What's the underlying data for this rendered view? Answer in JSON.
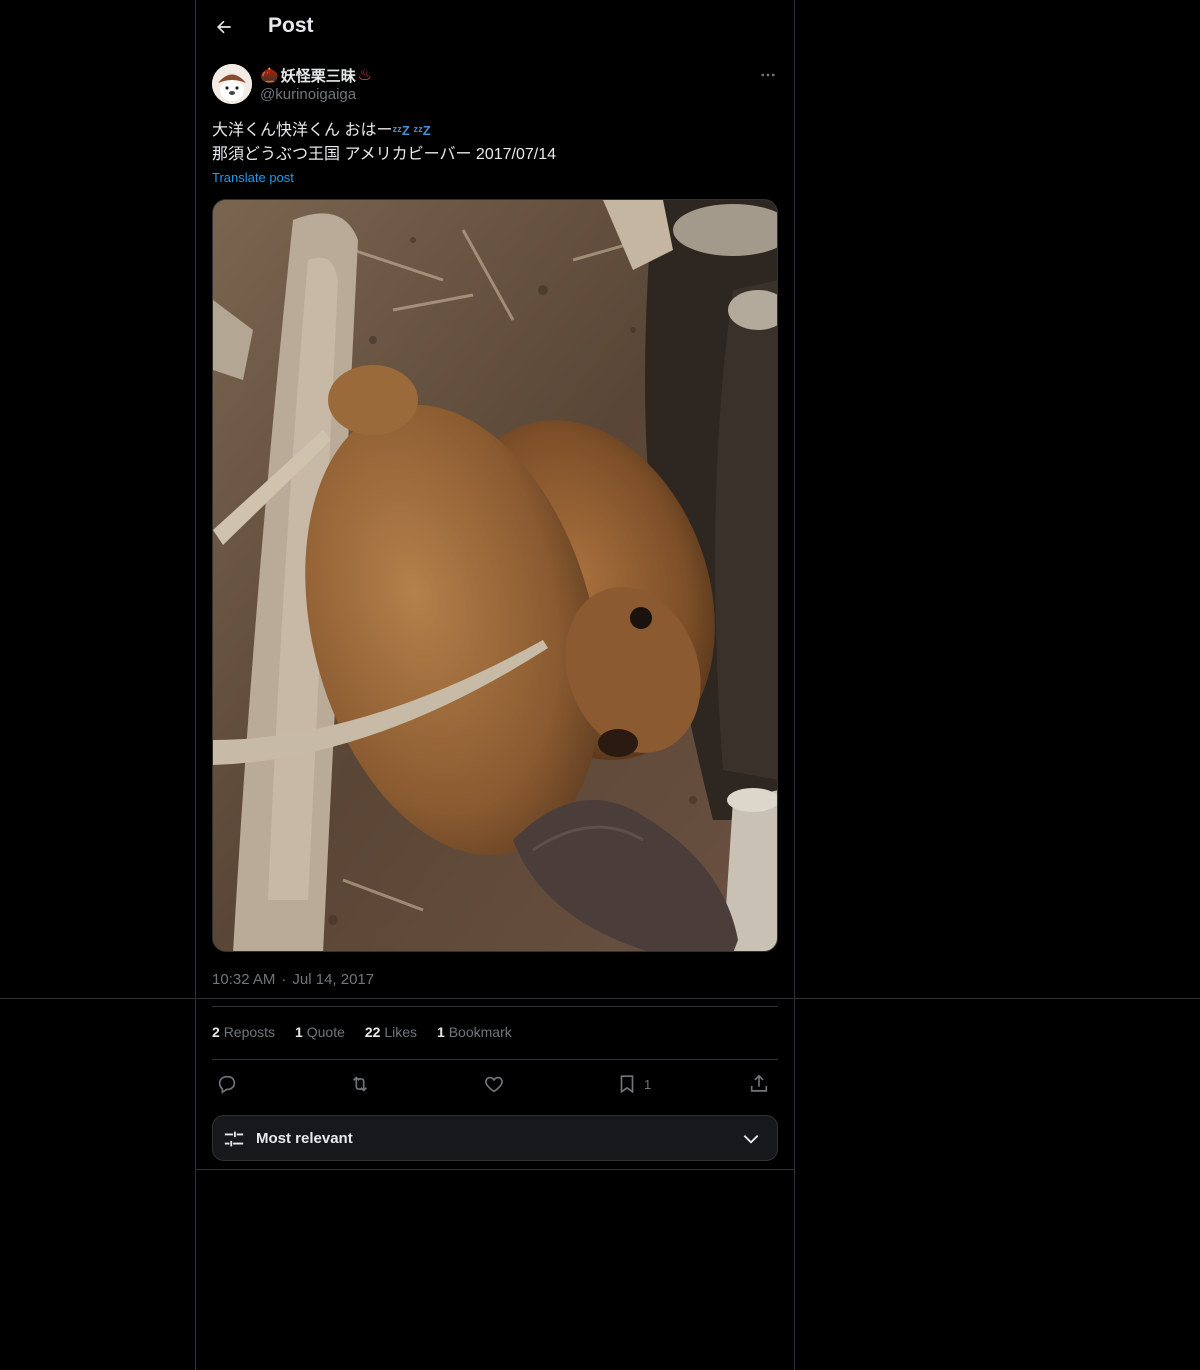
{
  "header": {
    "title": "Post"
  },
  "author": {
    "display_name": "妖怪栗三昧",
    "emoji_prefix": "🌰",
    "emoji_suffix": "♨",
    "handle": "@kurinoigaiga"
  },
  "post": {
    "line1": "大洋くん快洋くん おはー",
    "line1_emoji": "ᶻᶻZ ᶻᶻZ",
    "line2": "那須どうぶつ王国 アメリカビーバー 2017/07/14",
    "translate_label": "Translate post",
    "time": "10:32 AM",
    "separator": "·",
    "date": "Jul 14, 2017"
  },
  "stats": {
    "reposts_count": "2",
    "reposts_label": "Reposts",
    "quotes_count": "1",
    "quotes_label": "Quote",
    "likes_count": "22",
    "likes_label": "Likes",
    "bookmarks_count": "1",
    "bookmarks_label": "Bookmark"
  },
  "actions": {
    "bookmark_count": "1"
  },
  "sort": {
    "label": "Most relevant"
  },
  "icons": [
    "back-arrow-icon",
    "more-icon",
    "reply-icon",
    "repost-icon",
    "like-icon",
    "bookmark-icon",
    "share-icon",
    "sliders-icon",
    "chevron-down-icon"
  ],
  "colors": {
    "background": "#000000",
    "text": "#e7e9ea",
    "muted": "#71767b",
    "link": "#1d9bf0",
    "border": "#2f3336"
  }
}
